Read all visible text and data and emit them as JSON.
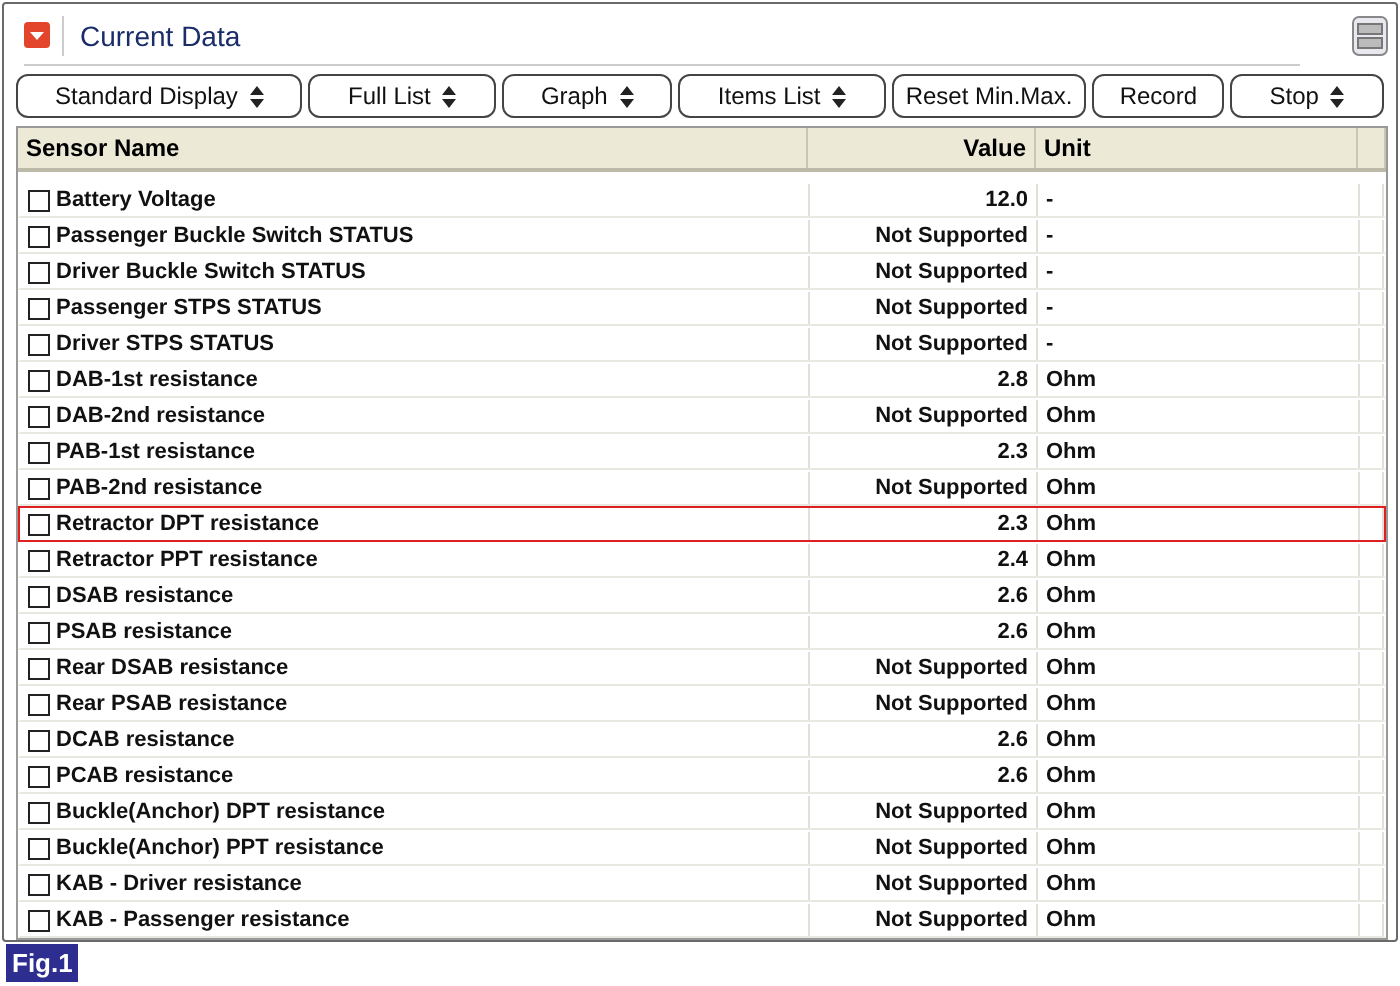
{
  "window": {
    "title": "Current Data"
  },
  "toolbar": [
    {
      "label": "Standard Display",
      "dropdown": true
    },
    {
      "label": "Full List",
      "dropdown": true
    },
    {
      "label": "Graph",
      "dropdown": true
    },
    {
      "label": "Items List",
      "dropdown": true
    },
    {
      "label": "Reset Min.Max.",
      "dropdown": false
    },
    {
      "label": "Record",
      "dropdown": false
    },
    {
      "label": "Stop",
      "dropdown": true
    }
  ],
  "table": {
    "columns": [
      "Sensor Name",
      "Value",
      "Unit"
    ],
    "rows": [
      {
        "name": "Battery Voltage",
        "value": "12.0",
        "unit": "-",
        "checked": false,
        "highlighted": false
      },
      {
        "name": "Passenger Buckle Switch STATUS",
        "value": "Not Supported",
        "unit": "-",
        "checked": false,
        "highlighted": false
      },
      {
        "name": "Driver Buckle Switch STATUS",
        "value": "Not Supported",
        "unit": "-",
        "checked": false,
        "highlighted": false
      },
      {
        "name": "Passenger STPS STATUS",
        "value": "Not Supported",
        "unit": "-",
        "checked": false,
        "highlighted": false
      },
      {
        "name": "Driver STPS STATUS",
        "value": "Not Supported",
        "unit": "-",
        "checked": false,
        "highlighted": false
      },
      {
        "name": "DAB-1st resistance",
        "value": "2.8",
        "unit": "Ohm",
        "checked": false,
        "highlighted": false
      },
      {
        "name": "DAB-2nd resistance",
        "value": "Not Supported",
        "unit": "Ohm",
        "checked": false,
        "highlighted": false
      },
      {
        "name": "PAB-1st resistance",
        "value": "2.3",
        "unit": "Ohm",
        "checked": false,
        "highlighted": false
      },
      {
        "name": "PAB-2nd resistance",
        "value": "Not Supported",
        "unit": "Ohm",
        "checked": false,
        "highlighted": false
      },
      {
        "name": "Retractor DPT resistance",
        "value": "2.3",
        "unit": "Ohm",
        "checked": false,
        "highlighted": true
      },
      {
        "name": "Retractor PPT resistance",
        "value": "2.4",
        "unit": "Ohm",
        "checked": false,
        "highlighted": false
      },
      {
        "name": "DSAB resistance",
        "value": "2.6",
        "unit": "Ohm",
        "checked": false,
        "highlighted": false
      },
      {
        "name": "PSAB resistance",
        "value": "2.6",
        "unit": "Ohm",
        "checked": false,
        "highlighted": false
      },
      {
        "name": "Rear DSAB resistance",
        "value": "Not Supported",
        "unit": "Ohm",
        "checked": false,
        "highlighted": false
      },
      {
        "name": "Rear PSAB resistance",
        "value": "Not Supported",
        "unit": "Ohm",
        "checked": false,
        "highlighted": false
      },
      {
        "name": "DCAB resistance",
        "value": "2.6",
        "unit": "Ohm",
        "checked": false,
        "highlighted": false
      },
      {
        "name": "PCAB resistance",
        "value": "2.6",
        "unit": "Ohm",
        "checked": false,
        "highlighted": false
      },
      {
        "name": "Buckle(Anchor) DPT resistance",
        "value": "Not Supported",
        "unit": "Ohm",
        "checked": false,
        "highlighted": false
      },
      {
        "name": "Buckle(Anchor) PPT resistance",
        "value": "Not Supported",
        "unit": "Ohm",
        "checked": false,
        "highlighted": false
      },
      {
        "name": "KAB - Driver resistance",
        "value": "Not Supported",
        "unit": "Ohm",
        "checked": false,
        "highlighted": false
      },
      {
        "name": "KAB - Passenger resistance",
        "value": "Not Supported",
        "unit": "Ohm",
        "checked": false,
        "highlighted": false
      }
    ]
  },
  "figure_label": "Fig.1"
}
